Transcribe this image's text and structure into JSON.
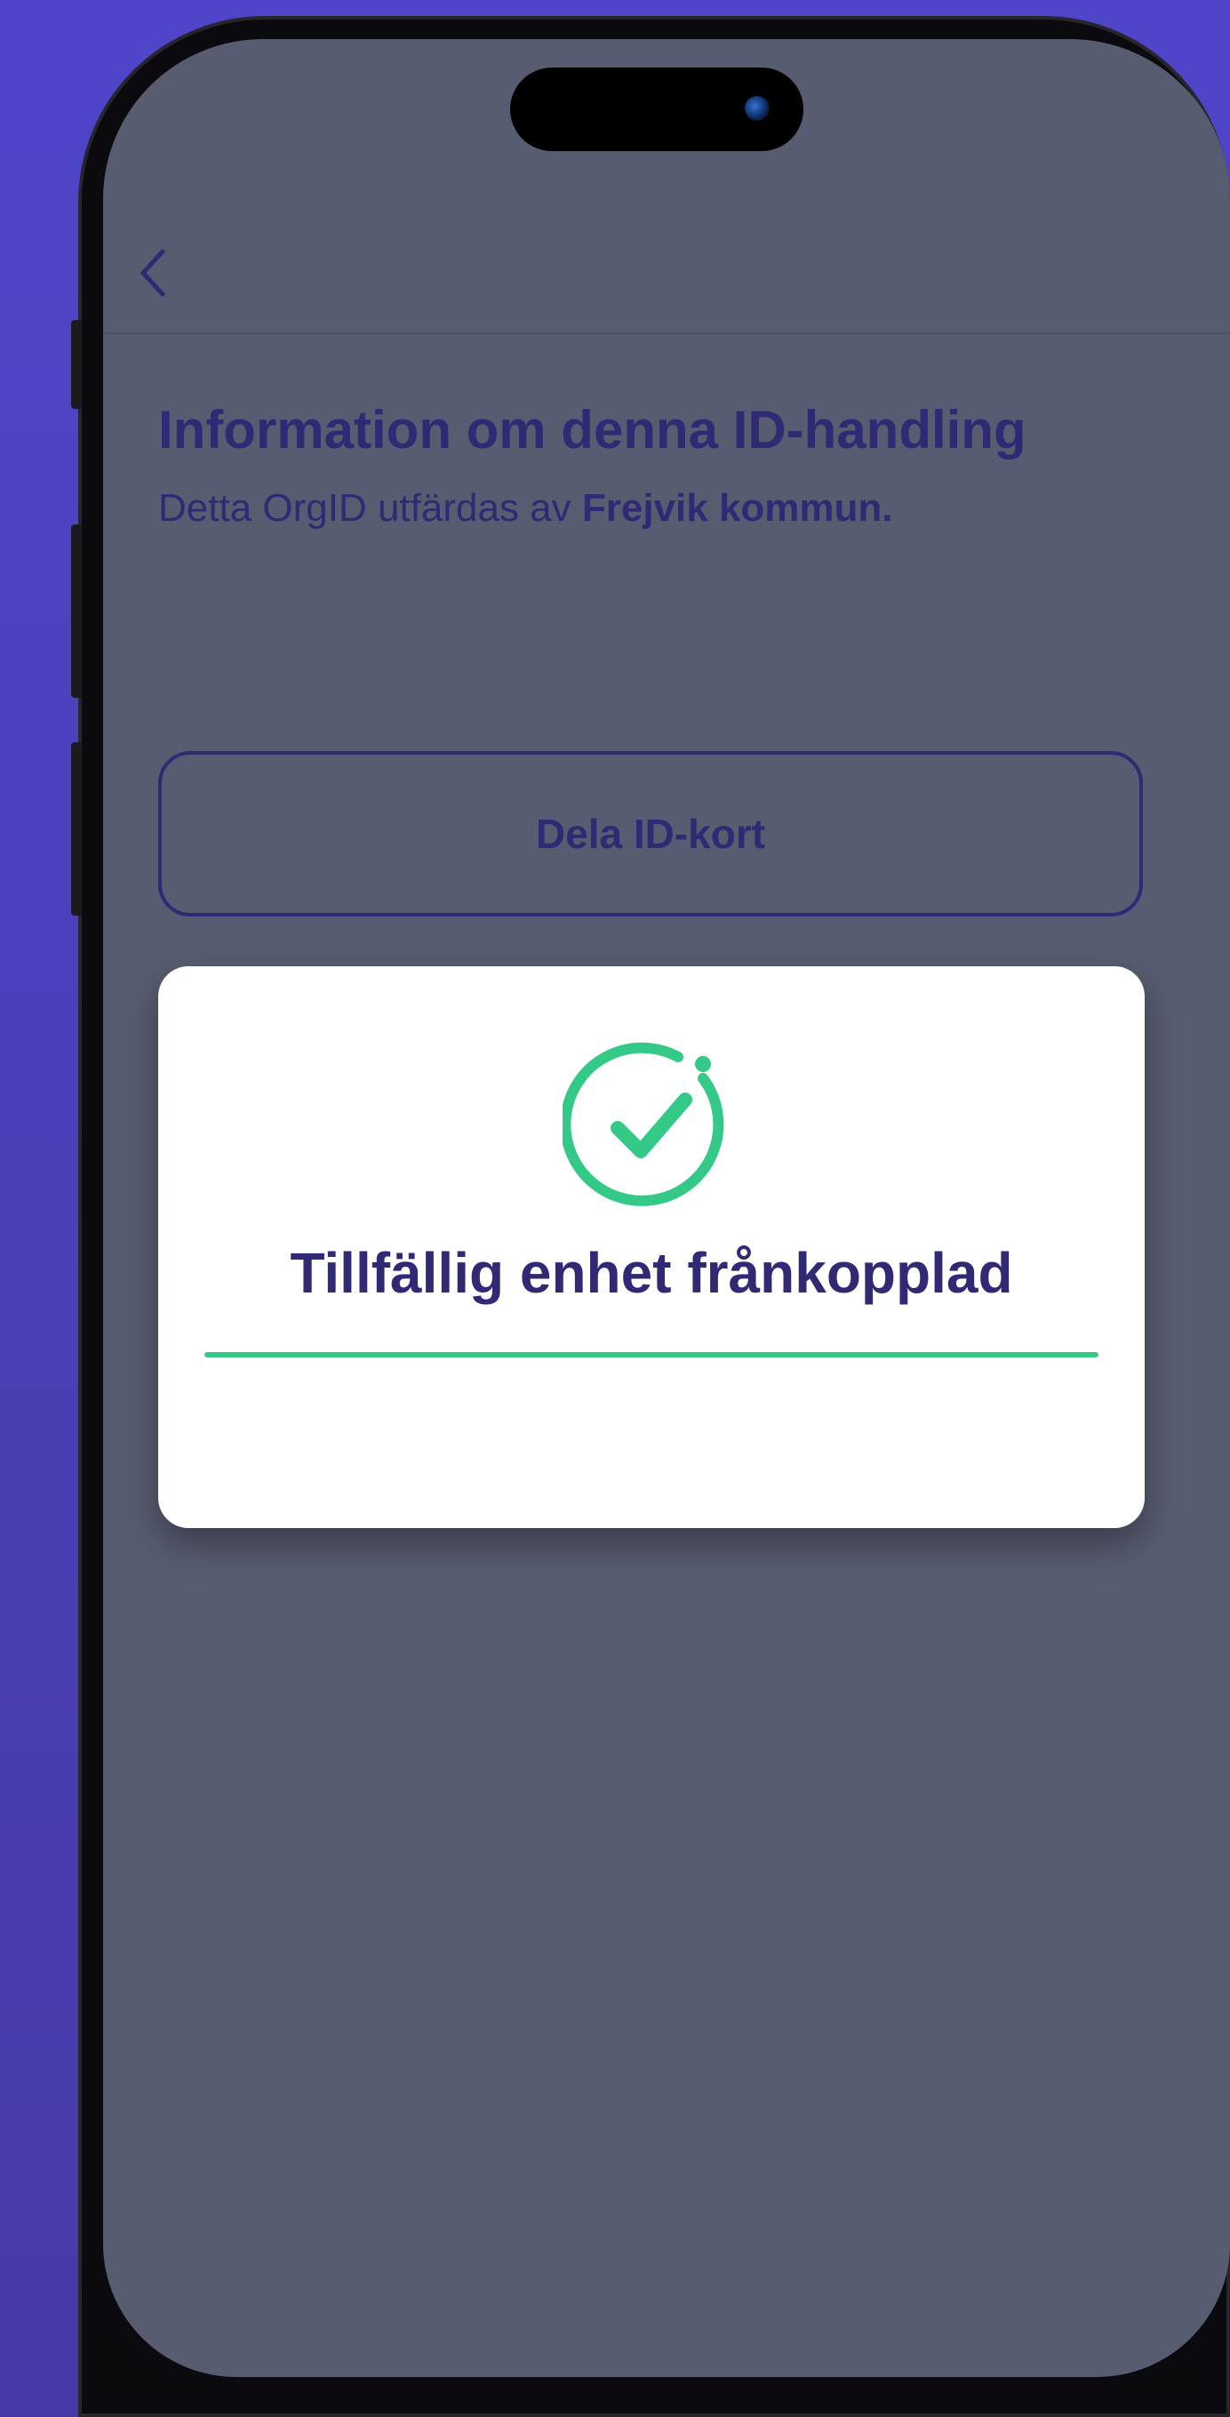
{
  "header": {
    "back_icon": "chevron-left-icon"
  },
  "main": {
    "heading": "Information om denna ID-handling",
    "description_prefix": "Detta OrgID utfärdas av ",
    "issuer": "Frejvik kommun.",
    "share_button_label": "Dela ID-kort"
  },
  "toast": {
    "icon": "check-circle-icon",
    "title": "Tillfällig enhet frånkopplad",
    "progress": 1.0
  },
  "colors": {
    "screen_background": "#585c70",
    "text_primary": "#2f2a73",
    "success": "#34c986",
    "page_background": "#4f45c9"
  }
}
